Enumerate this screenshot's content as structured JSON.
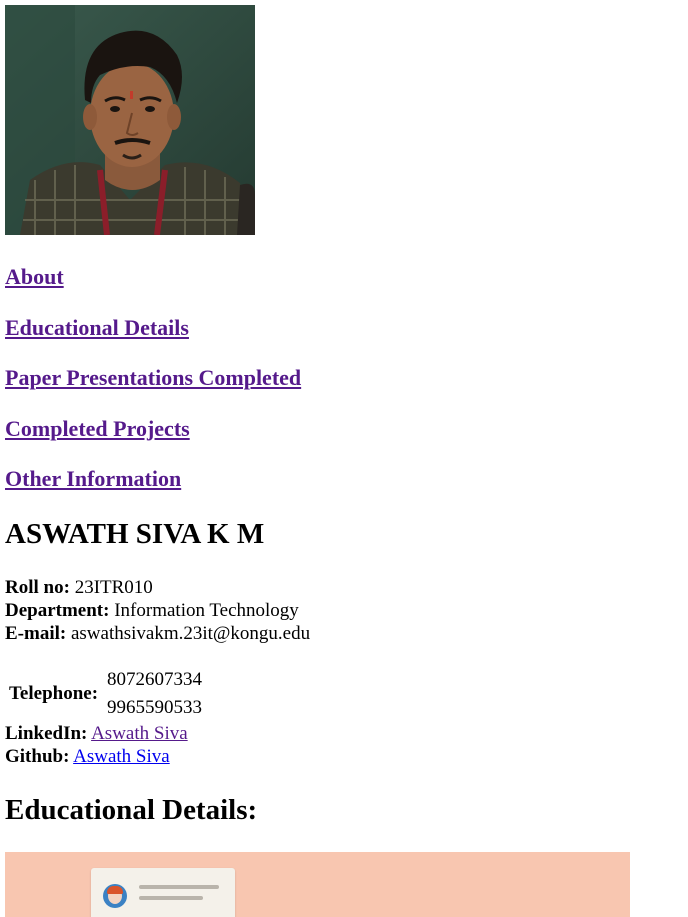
{
  "profile": {
    "photo_alt": "Profile photo"
  },
  "nav": {
    "about": "About",
    "educational_details": "Educational Details",
    "paper_presentations": "Paper Presentations Completed",
    "completed_projects": "Completed Projects",
    "other_information": "Other Information"
  },
  "person": {
    "name": "ASWATH SIVA K M",
    "roll_label": "Roll no:",
    "roll_value": "23ITR010",
    "department_label": "Department:",
    "department_value": "Information Technology",
    "email_label": "E-mail:",
    "email_value": "aswathsivakm.23it@kongu.edu",
    "telephone_label": "Telephone:",
    "telephone_values": [
      "8072607334",
      "9965590533"
    ],
    "linkedin_label": "LinkedIn:",
    "linkedin_value": "Aswath Siva",
    "github_label": "Github:",
    "github_value": "Aswath Siva"
  },
  "sections": {
    "educational_details_heading": "Educational Details:"
  },
  "colors": {
    "visited_link": "#551a8b",
    "unvisited_link": "#0000ee",
    "edu_image_bg": "#f8c6b0"
  }
}
